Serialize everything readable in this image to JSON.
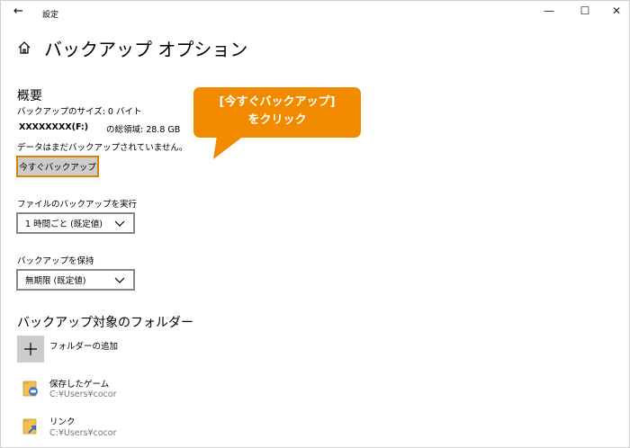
{
  "window": {
    "title": "設定",
    "minimize_glyph": "—",
    "maximize_glyph": "☐",
    "close_glyph": "✕",
    "back_glyph": "←"
  },
  "page": {
    "title": "バックアップ オプション",
    "home_icon": "home-icon"
  },
  "overview": {
    "heading": "概要",
    "backup_size": "バックアップのサイズ: 0 バイト",
    "drive_name": "XXXXXXXX(F:)",
    "total_space": "の総領域: 28.8 GB",
    "status": "データはまだバックアップされていません。",
    "backup_now_label": "今すぐバックアップ"
  },
  "callout": {
    "line1": "[今すぐバックアップ]",
    "line2": "をクリック",
    "color": "#f28a00"
  },
  "backup_frequency": {
    "label": "ファイルのバックアップを実行",
    "selected": "1 時間ごと (既定値)"
  },
  "keep_backups": {
    "label": "バックアップを保持",
    "selected": "無期限 (既定値)"
  },
  "folders": {
    "heading": "バックアップ対象のフォルダー",
    "add_label": "フォルダーの追加",
    "items": [
      {
        "name": "保存したゲーム",
        "path": "C:¥Users¥cocor",
        "icon": "saved-games-folder-icon"
      },
      {
        "name": "リンク",
        "path": "C:¥Users¥cocor",
        "icon": "links-folder-icon"
      }
    ]
  },
  "colors": {
    "accent_orange": "#e08000",
    "button_gray": "#cccccc"
  }
}
